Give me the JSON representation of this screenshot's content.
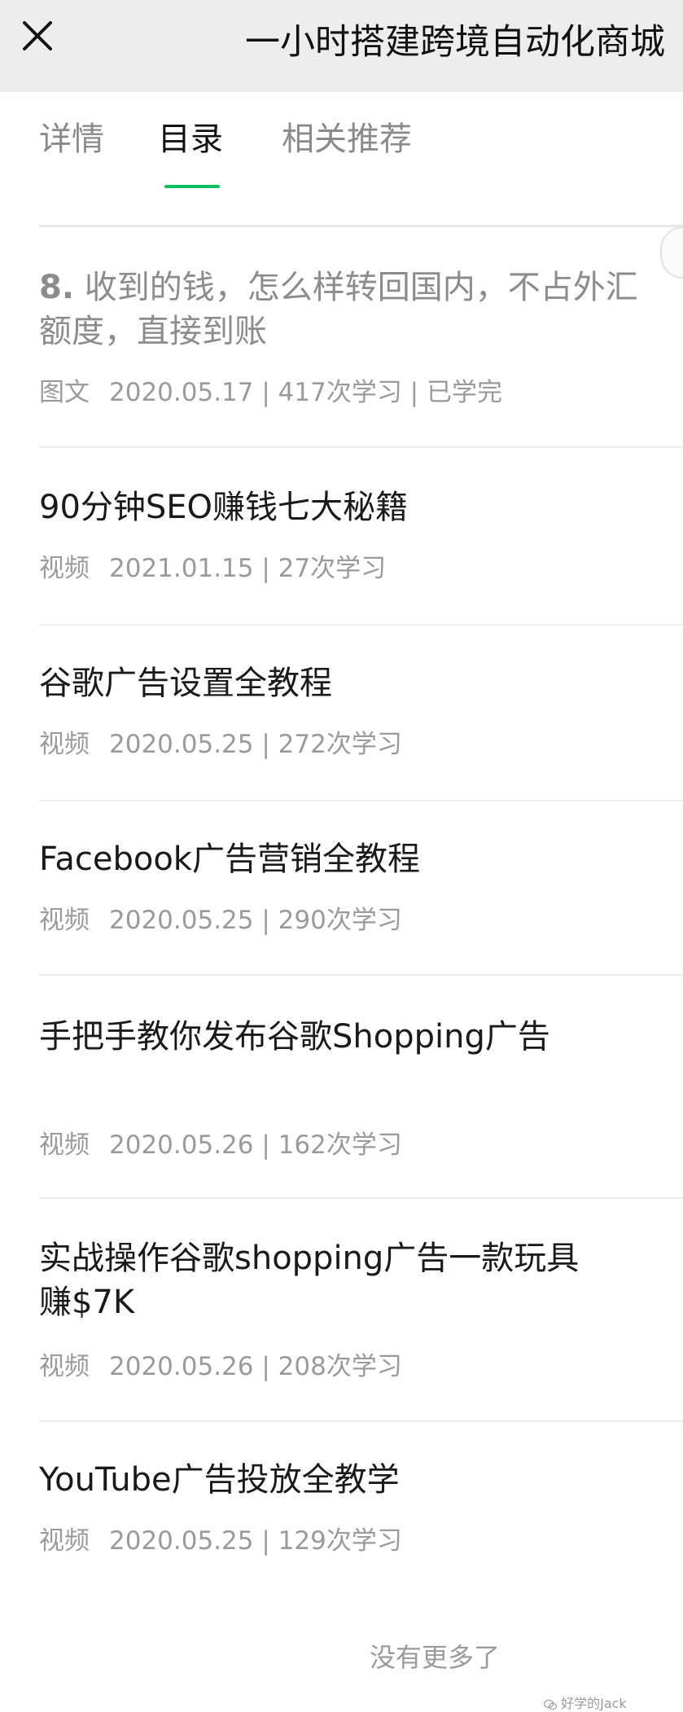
{
  "header": {
    "close_icon": "close-icon",
    "title": "一小时搭建跨境自动化商城"
  },
  "tabs": [
    {
      "label": "详情",
      "active": false
    },
    {
      "label": "目录",
      "active": true
    },
    {
      "label": "相关推荐",
      "active": false
    }
  ],
  "accent_color": "#07c160",
  "items": [
    {
      "number": "8.",
      "title": " 收到的钱，怎么样转回国内，不占外汇额度，直接到账",
      "type": "图文",
      "stats": "2020.05.17 | 417次学习 | 已学完"
    },
    {
      "title": "90分钟SEO赚钱七大秘籍",
      "type": "视频",
      "stats": "2021.01.15 | 27次学习"
    },
    {
      "title": "谷歌广告设置全教程",
      "type": "视频",
      "stats": "2020.05.25 | 272次学习"
    },
    {
      "title": "Facebook广告营销全教程",
      "type": "视频",
      "stats": "2020.05.25 | 290次学习"
    },
    {
      "title": "手把手教你发布谷歌Shopping广告",
      "type": "视频",
      "stats": "2020.05.26 | 162次学习"
    },
    {
      "title": "实战操作谷歌shopping广告一款玩具赚$7K",
      "type": "视频",
      "stats": "2020.05.26 | 208次学习"
    },
    {
      "title": "YouTube广告投放全教学",
      "type": "视频",
      "stats": "2020.05.25 | 129次学习"
    }
  ],
  "footer": {
    "no_more": "没有更多了"
  },
  "watermark": {
    "text": "好学的Jack"
  }
}
